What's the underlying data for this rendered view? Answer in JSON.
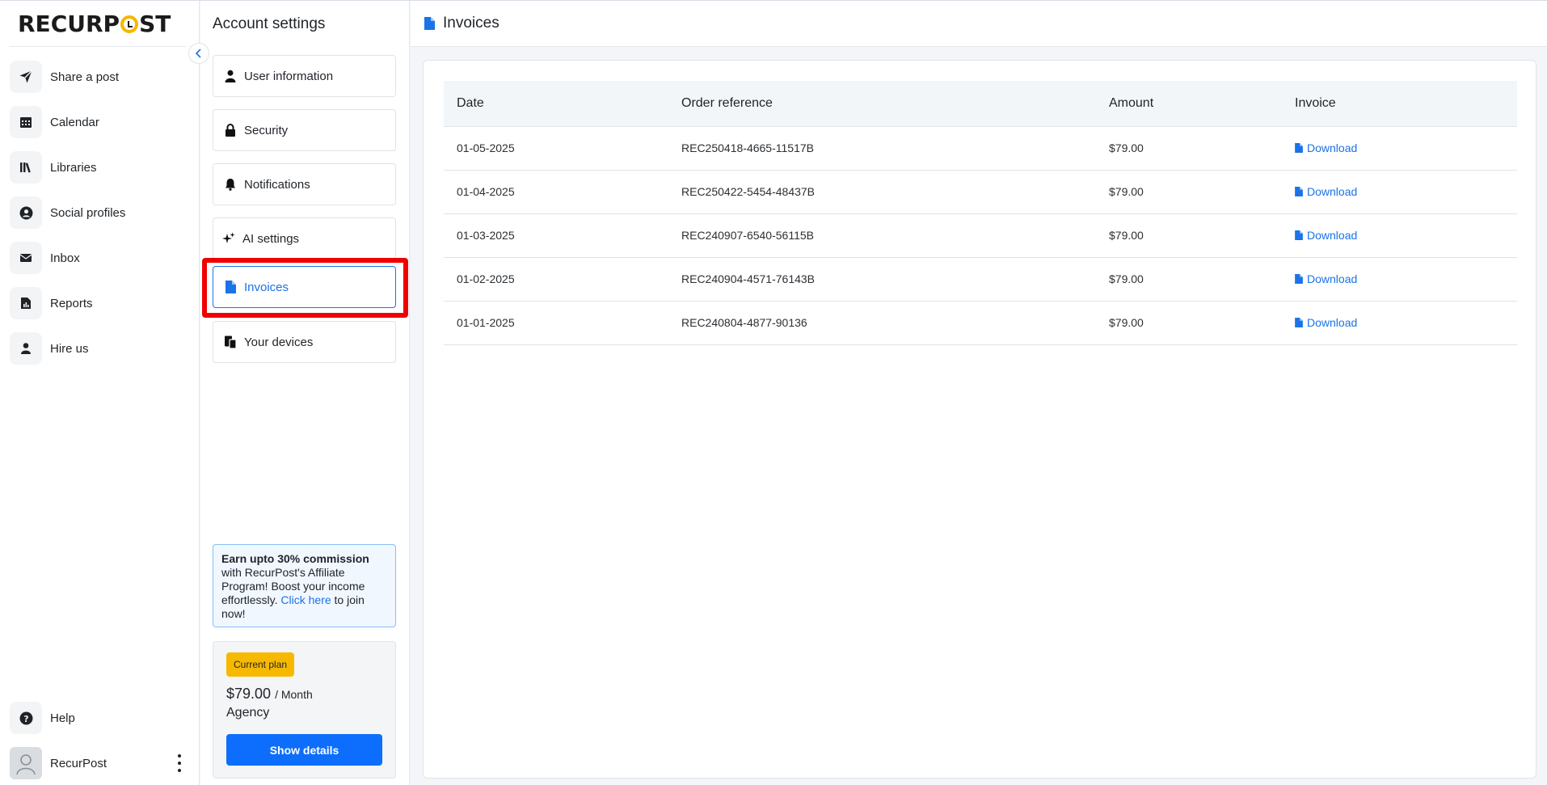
{
  "brand": {
    "name_part1": "RECURP",
    "name_part2": "ST",
    "accent": "#f5b700"
  },
  "nav": {
    "items": [
      {
        "label": "Share a post",
        "icon": "send-icon"
      },
      {
        "label": "Calendar",
        "icon": "calendar-icon"
      },
      {
        "label": "Libraries",
        "icon": "library-icon"
      },
      {
        "label": "Social profiles",
        "icon": "user-circle-icon"
      },
      {
        "label": "Inbox",
        "icon": "envelope-icon"
      },
      {
        "label": "Reports",
        "icon": "report-icon"
      },
      {
        "label": "Hire us",
        "icon": "person-icon"
      }
    ],
    "help_label": "Help",
    "user_name": "RecurPost"
  },
  "settings": {
    "title": "Account settings",
    "items": [
      {
        "label": "User information",
        "icon": "user-icon"
      },
      {
        "label": "Security",
        "icon": "lock-icon"
      },
      {
        "label": "Notifications",
        "icon": "bell-icon"
      },
      {
        "label": "AI settings",
        "icon": "sparkle-icon"
      },
      {
        "label": "Invoices",
        "icon": "file-icon",
        "active": true
      },
      {
        "label": "Your devices",
        "icon": "devices-icon"
      }
    ],
    "promo": {
      "bold": "Earn upto 30% commission",
      "text": " with RecurPost's Affiliate Program! Boost your income effortlessly. ",
      "link": "Click here",
      "tail": " to join now!"
    },
    "plan": {
      "badge": "Current plan",
      "price": "$79.00",
      "period": "/ Month",
      "name": "Agency",
      "button": "Show details"
    }
  },
  "main": {
    "title": "Invoices",
    "columns": [
      "Date",
      "Order reference",
      "Amount",
      "Invoice"
    ],
    "rows": [
      {
        "date": "01-05-2025",
        "ref": "REC250418-4665-11517B",
        "amount": "$79.00",
        "invoice": "Download"
      },
      {
        "date": "01-04-2025",
        "ref": "REC250422-5454-48437B",
        "amount": "$79.00",
        "invoice": "Download"
      },
      {
        "date": "01-03-2025",
        "ref": "REC240907-6540-56115B",
        "amount": "$79.00",
        "invoice": "Download"
      },
      {
        "date": "01-02-2025",
        "ref": "REC240904-4571-76143B",
        "amount": "$79.00",
        "invoice": "Download"
      },
      {
        "date": "01-01-2025",
        "ref": "REC240804-4877-90136",
        "amount": "$79.00",
        "invoice": "Download"
      }
    ]
  },
  "colors": {
    "primary": "#1a73e8",
    "button": "#0d6efd",
    "badge": "#f7b900",
    "highlight": "#f00000"
  }
}
